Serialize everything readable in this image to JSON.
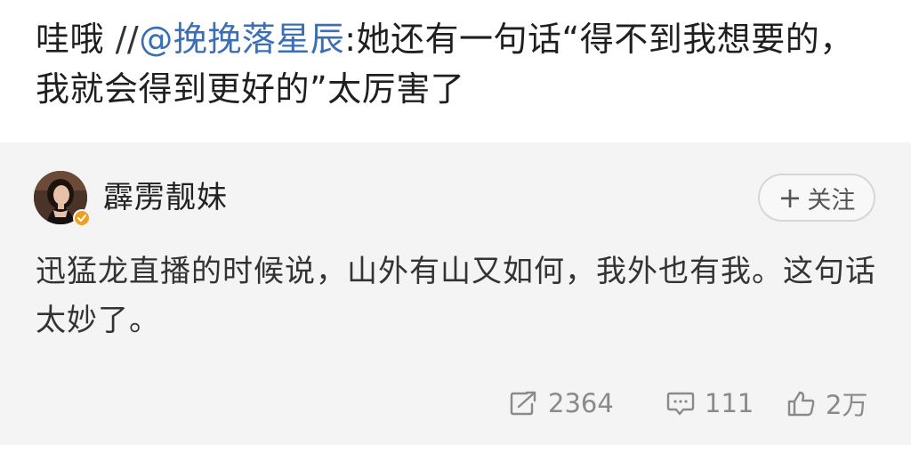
{
  "repost": {
    "prefix": "哇哦 ",
    "slashes": "//",
    "mention": "@挽挽落星辰",
    "content": ":她还有一句话“得不到我想要的，我就会得到更好的”太厉害了"
  },
  "original_post": {
    "author": {
      "name": "霹雳靓妹",
      "avatar_icon": "avatar-photo",
      "verified_icon": "verified-badge-icon",
      "verified_color": "#f0a020"
    },
    "follow_button": {
      "plus": "+",
      "label": "关注"
    },
    "body": "迅猛龙直播的时候说，山外有山又如何，我外也有我。这句话太妙了。",
    "actions": {
      "repost_count": "2364",
      "comment_count": "111",
      "like_count": "2万"
    }
  },
  "colors": {
    "mention": "#3a6fb5",
    "card_background": "#f4f4f4",
    "action_gray": "#8a8a8a"
  }
}
